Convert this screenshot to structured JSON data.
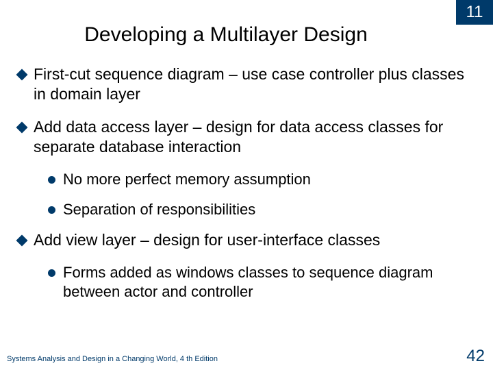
{
  "chapter": "11",
  "title": "Developing a Multilayer Design",
  "bullets": [
    {
      "level": 1,
      "text": "First-cut sequence diagram – use case controller plus classes in domain layer"
    },
    {
      "level": 1,
      "text": "Add data access layer – design for data access classes for separate database interaction"
    },
    {
      "level": 2,
      "text": "No more perfect memory assumption"
    },
    {
      "level": 2,
      "text": "Separation of responsibilities"
    },
    {
      "level": 1,
      "text": "Add view layer – design for user-interface classes"
    },
    {
      "level": 2,
      "text": "Forms added as windows classes to sequence diagram between actor and controller"
    }
  ],
  "footer_left": "Systems Analysis and Design in a Changing World, 4 th Edition",
  "page_number": "42"
}
